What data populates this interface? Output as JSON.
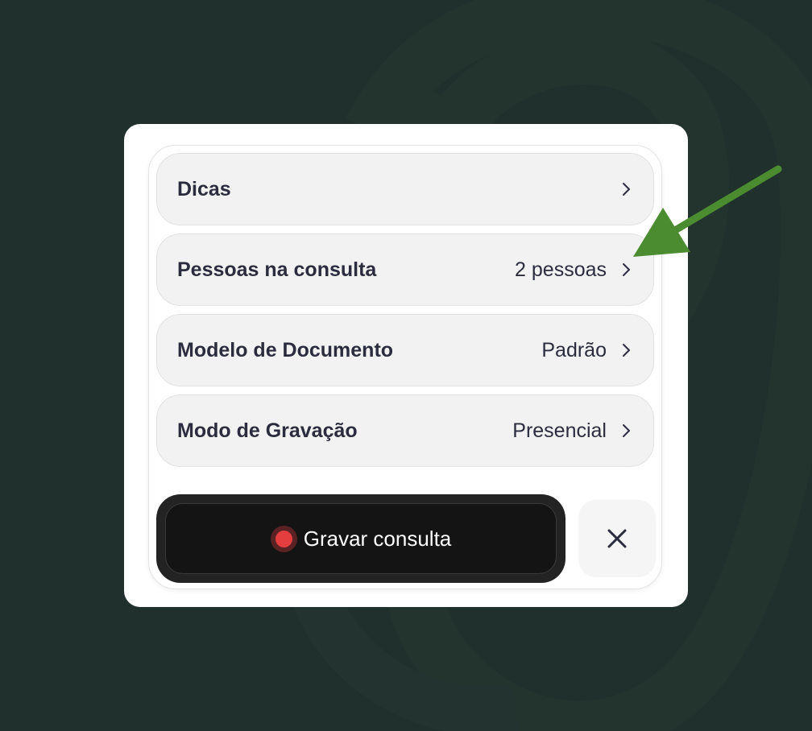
{
  "menu": {
    "items": [
      {
        "label": "Dicas",
        "value": ""
      },
      {
        "label": "Pessoas na consulta",
        "value": "2 pessoas"
      },
      {
        "label": "Modelo de Documento",
        "value": "Padrão"
      },
      {
        "label": "Modo de Gravação",
        "value": "Presencial"
      }
    ]
  },
  "actions": {
    "record_label": "Gravar consulta"
  },
  "icons": {
    "row_chevron": "chevron-right-icon",
    "record": "record-dot-icon",
    "close": "close-icon",
    "annotation": "green-arrow-annotation"
  },
  "colors": {
    "background": "#1f302d",
    "record_dot": "#e53e3e",
    "annotation_arrow": "#4a8c2f",
    "text_primary": "#2b2d3f"
  }
}
